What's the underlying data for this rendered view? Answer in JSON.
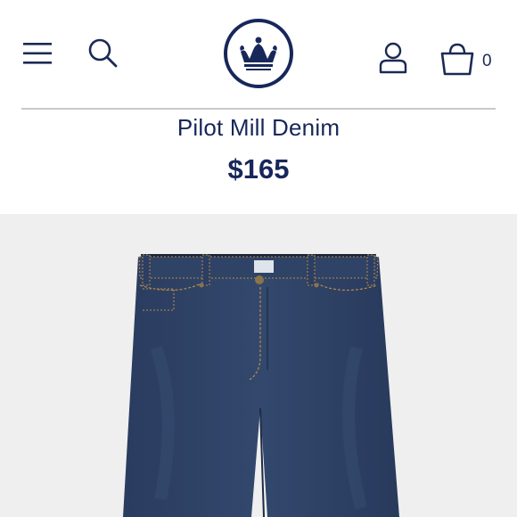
{
  "header": {
    "menu_icon": "hamburger-menu-icon",
    "search_icon": "search-icon",
    "logo_icon": "crown-logo-icon",
    "account_icon": "account-icon",
    "bag_icon": "shopping-bag-icon",
    "bag_count": "0"
  },
  "product": {
    "title": "Pilot Mill Denim",
    "price": "$165",
    "image_subject": "denim-jeans"
  },
  "colors": {
    "brand_navy": "#17275a",
    "denim": "#2c3e60",
    "image_bg": "#efefef"
  }
}
